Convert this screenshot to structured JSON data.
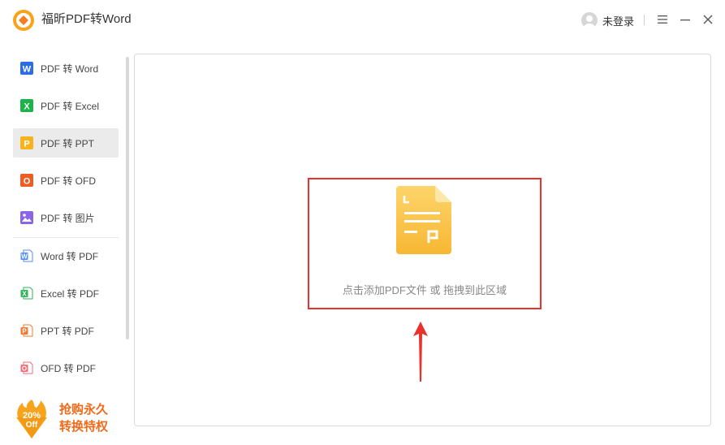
{
  "app": {
    "title": "福昕PDF转Word",
    "logo_icon": "foxit-logo-icon",
    "accent_color": "#f7a31c"
  },
  "user": {
    "label": "未登录",
    "avatar_icon": "user-avatar-icon"
  },
  "window_controls": {
    "menu_icon": "hamburger-menu-icon",
    "minimize_icon": "minimize-icon",
    "close_icon": "close-icon"
  },
  "sidebar": {
    "items": [
      {
        "label": "PDF 转 Word",
        "icon": "word-icon",
        "color": "#2b6de5",
        "letter": "W",
        "active": false
      },
      {
        "label": "PDF 转 Excel",
        "icon": "excel-icon",
        "color": "#1bb34a",
        "letter": "X",
        "active": false
      },
      {
        "label": "PDF 转 PPT",
        "icon": "ppt-icon",
        "color": "#f7b21c",
        "letter": "P",
        "active": true
      },
      {
        "label": "PDF 转 OFD",
        "icon": "ofd-icon",
        "color": "#f15a22",
        "letter": "O",
        "active": false
      },
      {
        "label": "PDF 转 图片",
        "icon": "image-icon",
        "color": "#8a65e8",
        "letter": "",
        "active": false
      },
      {
        "label": "Word 转 PDF",
        "icon": "word-to-pdf-icon",
        "color": "#4f8ef5",
        "letter": "W",
        "active": false
      },
      {
        "label": "Excel 转 PDF",
        "icon": "excel-to-pdf-icon",
        "color": "#2fb656",
        "letter": "X",
        "active": false
      },
      {
        "label": "PPT 转 PDF",
        "icon": "ppt-to-pdf-icon",
        "color": "#f27a2e",
        "letter": "P",
        "active": false
      },
      {
        "label": "OFD 转 PDF",
        "icon": "ofd-to-pdf-icon",
        "color": "#f26d78",
        "letter": "O",
        "active": false
      }
    ],
    "active_color": "#ebebeb"
  },
  "promo": {
    "badge_top": "20%",
    "badge_bottom": "Off",
    "line1": "抢购永久",
    "line2": "转换特权",
    "color": "#ef6b1b"
  },
  "dropzone": {
    "text": "点击添加PDF文件 或 拖拽到此区域",
    "file_icon": "ppt-file-icon",
    "highlight_color": "#e8322b"
  }
}
